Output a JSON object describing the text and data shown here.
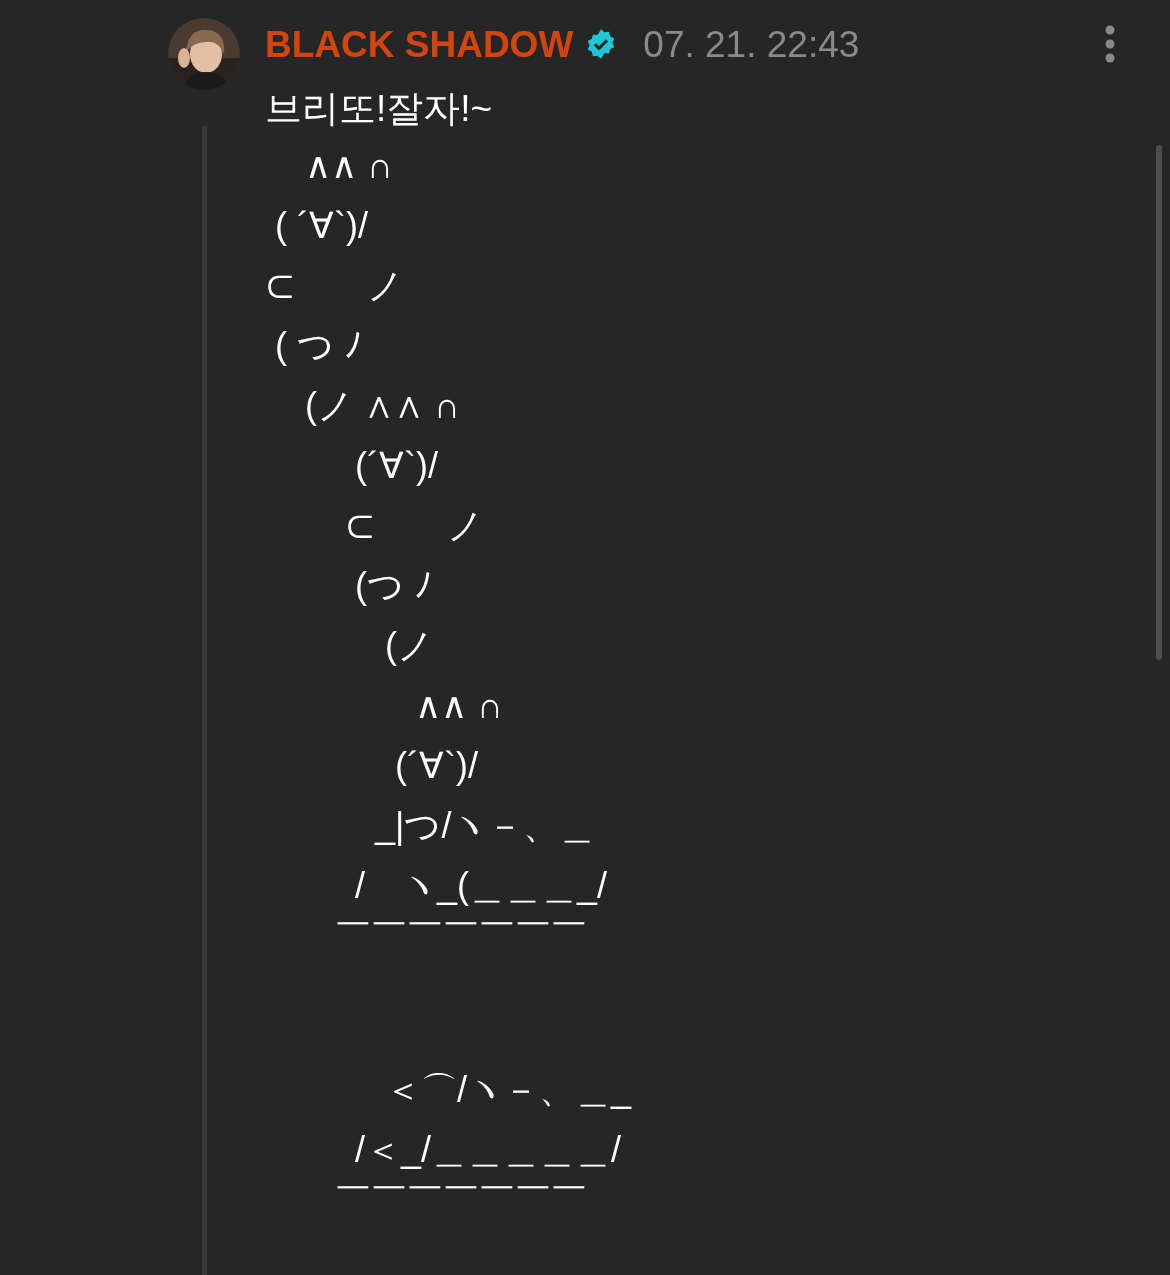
{
  "message": {
    "author": "BLACK SHADOW",
    "verified": true,
    "time": "07. 21. 22:43",
    "text": "브리또!잘자!~",
    "art_lines": [
      {
        "kind": "text",
        "text": "    ∧∧ ∩"
      },
      {
        "kind": "text",
        "text": " ( ´∀`)/"
      },
      {
        "kind": "text",
        "text": "⊂　　ノ"
      },
      {
        "kind": "text",
        "text": " ( つ ﾉ"
      },
      {
        "kind": "text",
        "text": "    (ノ ∧∧ ∩"
      },
      {
        "kind": "text",
        "text": "         (´∀`)/"
      },
      {
        "kind": "text",
        "text": "        ⊂　　ノ"
      },
      {
        "kind": "text",
        "text": "         (つ ﾉ"
      },
      {
        "kind": "text",
        "text": "            (ノ"
      },
      {
        "kind": "text",
        "text": "               ∧∧ ∩"
      },
      {
        "kind": "text",
        "text": "             (´∀`)/"
      },
      {
        "kind": "text",
        "text": "           _|つ/ヽ－、＿"
      },
      {
        "kind": "text",
        "text": "         /　ヽ_(＿＿＿_/"
      },
      {
        "kind": "rule",
        "text": "       ￣￣￣￣￣￣￣"
      },
      {
        "kind": "blank"
      },
      {
        "kind": "blank"
      },
      {
        "kind": "text",
        "text": "            ＜⌒/ヽ－、＿_"
      },
      {
        "kind": "text",
        "text": "         /＜_/＿＿＿＿＿/"
      },
      {
        "kind": "rule",
        "text": "       ￣￣￣￣￣￣￣"
      }
    ]
  }
}
